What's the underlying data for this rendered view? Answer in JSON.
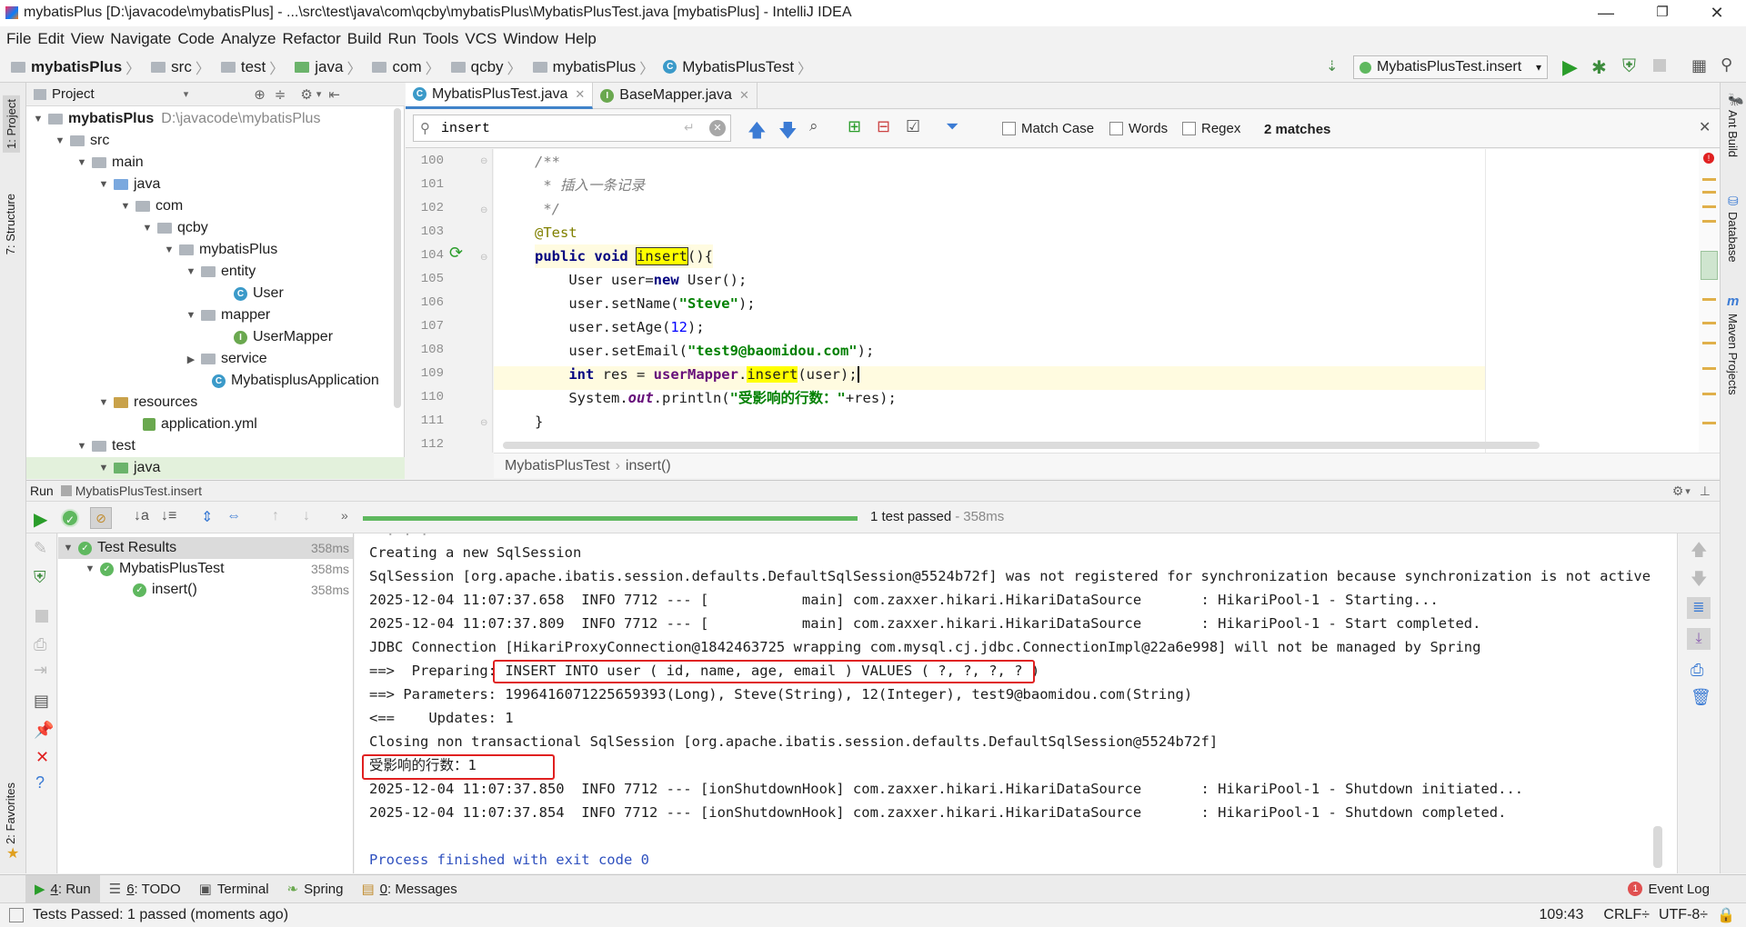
{
  "window": {
    "title": "mybatisPlus [D:\\javacode\\mybatisPlus] - ...\\src\\test\\java\\com\\qcby\\mybatisPlus\\MybatisPlusTest.java [mybatisPlus] - IntelliJ IDEA"
  },
  "menu": [
    "File",
    "Edit",
    "View",
    "Navigate",
    "Code",
    "Analyze",
    "Refactor",
    "Build",
    "Run",
    "Tools",
    "VCS",
    "Window",
    "Help"
  ],
  "breadcrumbs": [
    "mybatisPlus",
    "src",
    "test",
    "java",
    "com",
    "qcby",
    "mybatisPlus",
    "MybatisPlusTest"
  ],
  "run_config": "MybatisPlusTest.insert",
  "left_tabs": {
    "project": "1: Project",
    "structure": "7: Structure",
    "favorites": "2: Favorites"
  },
  "right_tabs": {
    "ant": "Ant Build",
    "database": "Database",
    "maven": "Maven Projects"
  },
  "project": {
    "header": "Project",
    "tree": [
      {
        "label": "mybatisPlus",
        "path": "D:\\javacode\\mybatisPlus"
      },
      {
        "label": "src"
      },
      {
        "label": "main"
      },
      {
        "label": "java"
      },
      {
        "label": "com"
      },
      {
        "label": "qcby"
      },
      {
        "label": "mybatisPlus"
      },
      {
        "label": "entity"
      },
      {
        "label": "User"
      },
      {
        "label": "mapper"
      },
      {
        "label": "UserMapper"
      },
      {
        "label": "service"
      },
      {
        "label": "MybatisplusApplication"
      },
      {
        "label": "resources"
      },
      {
        "label": "application.yml"
      },
      {
        "label": "test"
      },
      {
        "label": "java"
      }
    ]
  },
  "editor": {
    "tabs": [
      "MybatisPlusTest.java",
      "BaseMapper.java"
    ],
    "find": {
      "query": "insert",
      "match_case": "Match Case",
      "words": "Words",
      "regex": "Regex",
      "matches": "2 matches"
    },
    "line_numbers": [
      "100",
      "101",
      "102",
      "103",
      "104",
      "105",
      "106",
      "107",
      "108",
      "109",
      "110",
      "111",
      "112"
    ],
    "code": {
      "l100": "/**",
      "l101": " * 插入一条记录",
      "l102": " */",
      "l103": "@Test",
      "l104_kw1": "public",
      "l104_kw2": "void",
      "l104_name": "insert",
      "l104_rest": "(){",
      "l105_a": "    User user=",
      "l105_kw": "new",
      "l105_b": " User();",
      "l106_a": "    user.setName(",
      "l106_s": "\"Steve\"",
      "l106_b": ");",
      "l107_a": "    user.setAge(",
      "l107_n": "12",
      "l107_b": ");",
      "l108_a": "    user.setEmail(",
      "l108_s": "\"test9@baomidou.com\"",
      "l108_b": ");",
      "l109_kw": "int",
      "l109_a": " res = ",
      "l109_f": "userMapper",
      "l109_dot": ".",
      "l109_m": "insert",
      "l109_b": "(user);",
      "l110_a": "    System.",
      "l110_out": "out",
      "l110_b": ".println(",
      "l110_s": "\"受影响的行数：\"",
      "l110_c": "+res);",
      "l111": "}"
    },
    "crumbs": [
      "MybatisPlusTest",
      "insert()"
    ]
  },
  "run": {
    "title": "Run",
    "config": "MybatisPlusTest.insert",
    "progress": 1.0,
    "summary": "1 test passed",
    "duration": "358ms",
    "tree": [
      {
        "label": "Test Results",
        "time": "358ms"
      },
      {
        "label": "MybatisPlusTest",
        "time": "358ms"
      },
      {
        "label": "insert()",
        "time": "358ms"
      }
    ],
    "console": [
      "Creating a new SqlSession",
      "SqlSession [org.apache.ibatis.session.defaults.DefaultSqlSession@5524b72f] was not registered for synchronization because synchronization is not active",
      "2025-12-04 11:07:37.658  INFO 7712 --- [           main] com.zaxxer.hikari.HikariDataSource       : HikariPool-1 - Starting...",
      "2025-12-04 11:07:37.809  INFO 7712 --- [           main] com.zaxxer.hikari.HikariDataSource       : HikariPool-1 - Start completed.",
      "JDBC Connection [HikariProxyConnection@1842463725 wrapping com.mysql.cj.jdbc.ConnectionImpl@22a6e998] will not be managed by Spring",
      "==>  Preparing: ",
      "INSERT INTO user ( id, name, age, email ) VALUES ( ?, ?, ?, ? )",
      "==> Parameters: 1996416071225659393(Long), Steve(String), 12(Integer), test9@baomidou.com(String)",
      "<==    Updates: 1",
      "Closing non transactional SqlSession [org.apache.ibatis.session.defaults.DefaultSqlSession@5524b72f]",
      "受影响的行数：1",
      "2025-12-04 11:07:37.850  INFO 7712 --- [ionShutdownHook] com.zaxxer.hikari.HikariDataSource       : HikariPool-1 - Shutdown initiated...",
      "2025-12-04 11:07:37.854  INFO 7712 --- [ionShutdownHook] com.zaxxer.hikari.HikariDataSource       : HikariPool-1 - Shutdown completed.",
      "Process finished with exit code 0"
    ]
  },
  "bottom_tabs": [
    {
      "key": "4",
      "label": ": Run"
    },
    {
      "key": "6",
      "label": ": TODO"
    },
    {
      "key": "",
      "label": "Terminal"
    },
    {
      "key": "",
      "label": "Spring"
    },
    {
      "key": "0",
      "label": ": Messages"
    }
  ],
  "event_log": {
    "label": "Event Log",
    "count": "1"
  },
  "status": {
    "message": "Tests Passed: 1 passed (moments ago)",
    "position": "109:43",
    "line_sep": "CRLF÷",
    "encoding": "UTF-8÷"
  },
  "colors": {
    "accent": "#4083c9",
    "pass": "#5fb85f",
    "highlight": "#ffff00",
    "error_box": "#e02020",
    "run_green": "#2a9d2a"
  }
}
